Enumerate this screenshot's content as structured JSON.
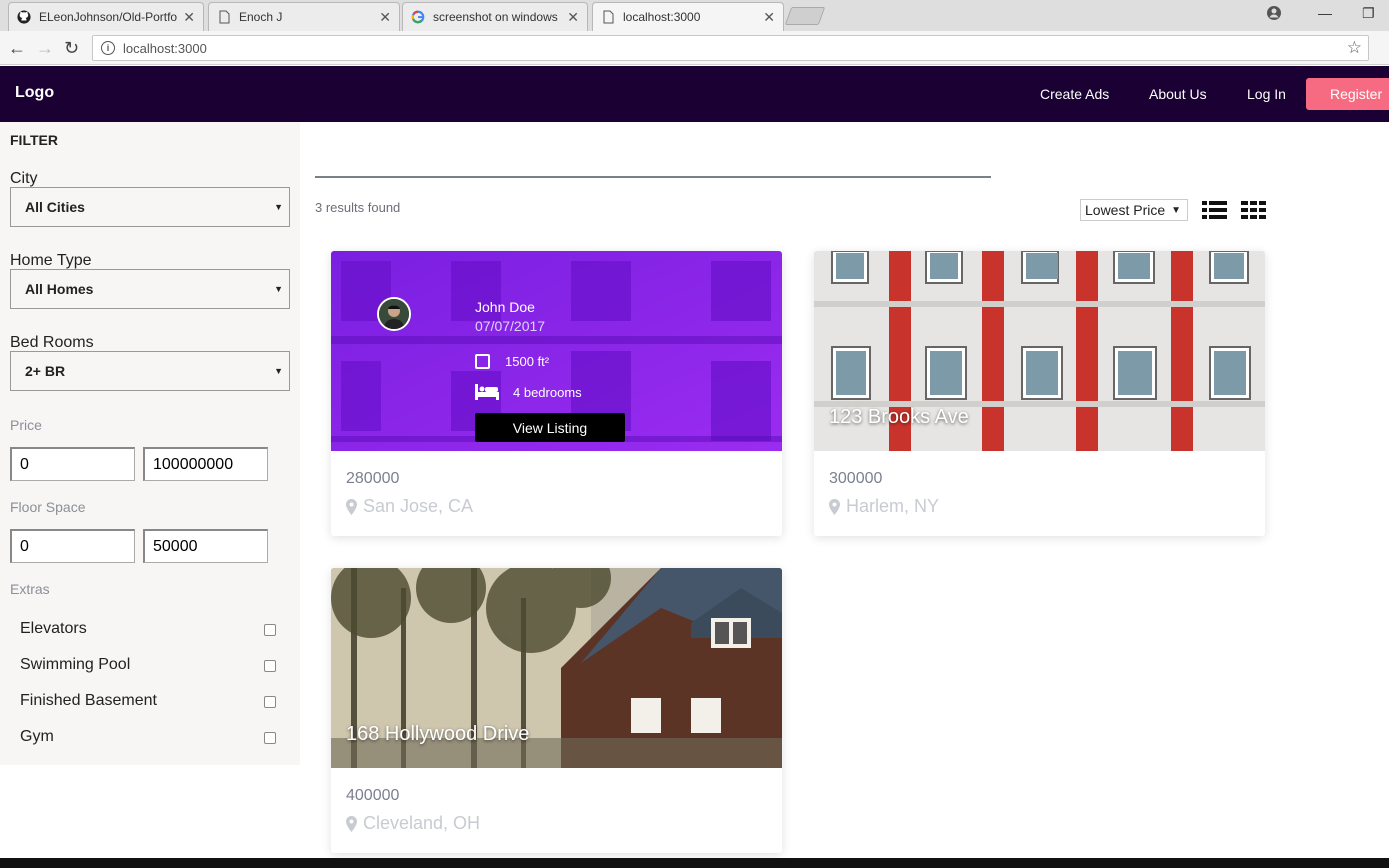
{
  "browser": {
    "tabs": [
      {
        "title": "ELeonJohnson/Old-Portfo",
        "icon": "github-icon"
      },
      {
        "title": "Enoch J",
        "icon": "page-icon"
      },
      {
        "title": "screenshot on windows 1",
        "icon": "google-icon"
      },
      {
        "title": "localhost:3000",
        "icon": "page-icon",
        "active": true
      }
    ],
    "address": "localhost:3000"
  },
  "header": {
    "logo": "Logo",
    "nav": [
      "Create Ads",
      "About Us",
      "Log In"
    ],
    "register": "Register",
    "bg_color": "#1a0033",
    "accent_color": "#f76b82"
  },
  "filter": {
    "title": "FILTER",
    "city": {
      "label": "City",
      "value": "All Cities"
    },
    "home_type": {
      "label": "Home Type",
      "value": "All Homes"
    },
    "bedrooms": {
      "label": "Bed Rooms",
      "value": "2+ BR"
    },
    "price": {
      "label": "Price",
      "min": "0",
      "max": "100000000"
    },
    "floor_space": {
      "label": "Floor Space",
      "min": "0",
      "max": "50000"
    },
    "extras": {
      "label": "Extras",
      "items": [
        "Elevators",
        "Swimming Pool",
        "Finished Basement",
        "Gym"
      ]
    }
  },
  "results": {
    "count_text": "3 results found",
    "sort": "Lowest Price",
    "view_icons": [
      "list-view-icon",
      "grid-view-icon"
    ]
  },
  "listings": [
    {
      "address": "",
      "price": "280000",
      "location": "San Jose, CA",
      "overlay": {
        "name": "John Doe",
        "date": "07/07/2017",
        "floor": "1500 ft²",
        "bedrooms": "4 bedrooms",
        "button": "View Listing"
      }
    },
    {
      "address": "123 Brooks Ave",
      "price": "300000",
      "location": "Harlem, NY"
    },
    {
      "address": "168 Hollywood Drive",
      "price": "400000",
      "location": "Cleveland, OH"
    }
  ]
}
